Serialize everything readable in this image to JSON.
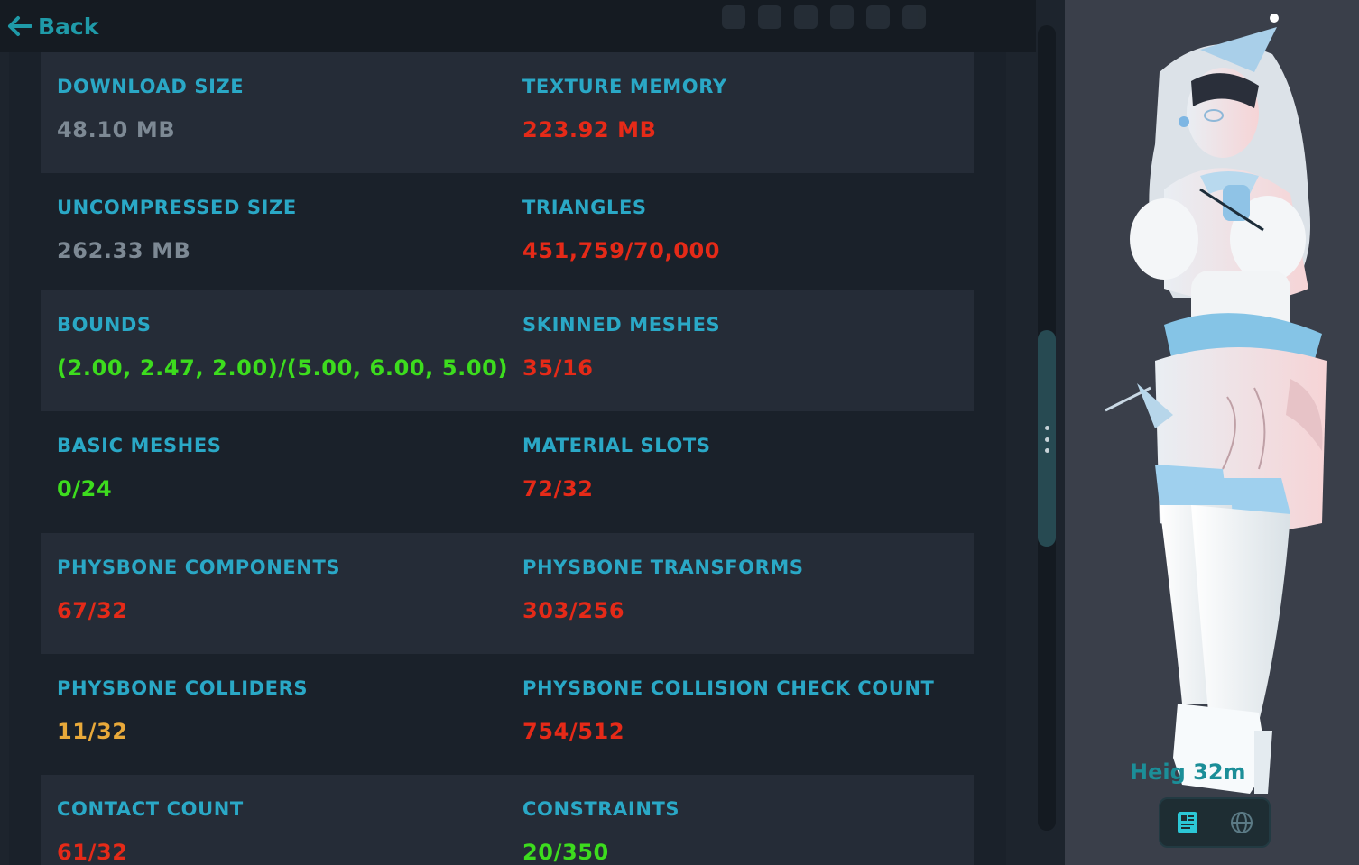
{
  "nav": {
    "back_label": "Back"
  },
  "stats": [
    {
      "row": 0,
      "left": {
        "label": "DOWNLOAD SIZE",
        "value": "48.10 MB",
        "color": "gray"
      },
      "right": {
        "label": "TEXTURE MEMORY",
        "value": "223.92 MB",
        "color": "red"
      }
    },
    {
      "row": 1,
      "left": {
        "label": "UNCOMPRESSED SIZE",
        "value": "262.33 MB",
        "color": "gray"
      },
      "right": {
        "label": "TRIANGLES",
        "value": "451,759/70,000",
        "color": "red"
      }
    },
    {
      "row": 2,
      "left": {
        "label": "BOUNDS",
        "value": "(2.00, 2.47, 2.00)/(5.00, 6.00, 5.00)",
        "color": "green"
      },
      "right": {
        "label": "SKINNED MESHES",
        "value": "35/16",
        "color": "red"
      }
    },
    {
      "row": 3,
      "left": {
        "label": "BASIC MESHES",
        "value": "0/24",
        "color": "green"
      },
      "right": {
        "label": "MATERIAL SLOTS",
        "value": "72/32",
        "color": "red"
      }
    },
    {
      "row": 4,
      "left": {
        "label": "PHYSBONE COMPONENTS",
        "value": "67/32",
        "color": "red"
      },
      "right": {
        "label": "PHYSBONE TRANSFORMS",
        "value": "303/256",
        "color": "red"
      }
    },
    {
      "row": 5,
      "left": {
        "label": "PHYSBONE COLLIDERS",
        "value": "11/32",
        "color": "orange"
      },
      "right": {
        "label": "PHYSBONE COLLISION CHECK COUNT",
        "value": "754/512",
        "color": "red"
      }
    },
    {
      "row": 6,
      "left": {
        "label": "CONTACT COUNT",
        "value": "61/32",
        "color": "red"
      },
      "right": {
        "label": "CONSTRAINTS",
        "value": "20/350",
        "color": "green"
      }
    }
  ],
  "preview": {
    "height_text": "Heig     32m",
    "toggle_icons": [
      "avatar-card-icon",
      "globe-icon"
    ]
  },
  "colors": {
    "accent": "#1f9aa8",
    "label": "#2aa8c6",
    "gray": "#7d8994",
    "red": "#e52a18",
    "green": "#3ddc1e",
    "orange": "#e8a93a"
  }
}
